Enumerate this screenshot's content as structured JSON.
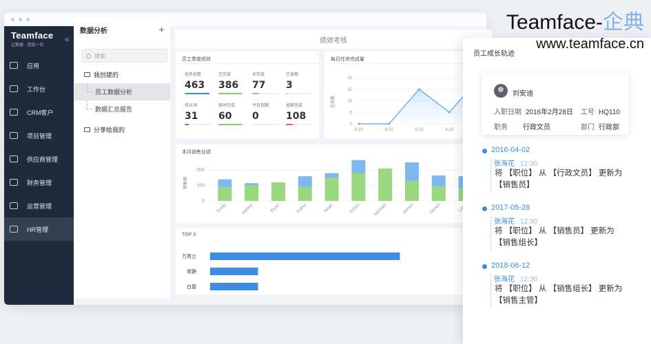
{
  "brand": {
    "name": "Teamface",
    "tagline": "让数据 · 连接一切",
    "collapse_icon": "double-chevron-left"
  },
  "nav": [
    {
      "label": "应用",
      "icon": "apps-icon"
    },
    {
      "label": "工作台",
      "icon": "workbench-icon"
    },
    {
      "label": "CRM客户",
      "icon": "customer-icon"
    },
    {
      "label": "项目管理",
      "icon": "project-icon"
    },
    {
      "label": "供应商管理",
      "icon": "supplier-icon"
    },
    {
      "label": "财务管理",
      "icon": "finance-icon"
    },
    {
      "label": "运营管理",
      "icon": "operations-icon"
    },
    {
      "label": "HR管理",
      "icon": "hr-icon",
      "active": true
    }
  ],
  "subpanel": {
    "title": "数据分析",
    "add": "+",
    "search_placeholder": "搜索",
    "group1": "我创建的",
    "items": [
      "员工数据分析",
      "数据汇总报告"
    ],
    "group2": "分享给我的"
  },
  "main": {
    "title": "绩效考核",
    "card1_title": "员工季度绩效",
    "stats": [
      {
        "label": "任务总数",
        "value": "463",
        "color": "#3d8ce6",
        "fill": 0.95
      },
      {
        "label": "已完成",
        "value": "386",
        "color": "#7ccf6b",
        "fill": 0.9
      },
      {
        "label": "未完成",
        "value": "77",
        "color": "#f29b8e",
        "fill": 0.25
      },
      {
        "label": "已逾期",
        "value": "3",
        "color": "#f29b8e",
        "fill": 0.05
      },
      {
        "label": "待认领",
        "value": "31",
        "color": "#3d8ce6",
        "fill": 0.15
      },
      {
        "label": "按时完成",
        "value": "60",
        "color": "#7ccf6b",
        "fill": 0.9
      },
      {
        "label": "今日到期",
        "value": "0",
        "color": "#f29b8e",
        "fill": 0.0
      },
      {
        "label": "逾期完成",
        "value": "108",
        "color": "#e85c4a",
        "fill": 0.25
      }
    ],
    "card2_title": "每日任务完成量",
    "card2_ylabel": "任务数",
    "card3_title": "本月销售业绩",
    "card3_ylabel": "销售额",
    "card4_title": "TOP 3"
  },
  "chart_data": [
    {
      "type": "line",
      "title": "每日任务完成量",
      "ylabel": "任务数",
      "x": [
        "6-20",
        "6-21",
        "6-22",
        "6-23",
        "6-24"
      ],
      "values": [
        0,
        0,
        15,
        5,
        20
      ],
      "yticks": [
        0,
        5,
        10,
        15,
        20
      ],
      "ylim": [
        0,
        20
      ],
      "color": "#5aa3ea"
    },
    {
      "type": "bar",
      "stacked": true,
      "title": "本月销售业绩",
      "ylabel": "销售额",
      "categories": [
        "Emily",
        "Ashley",
        "Ryan",
        "Kathy",
        "Noah",
        "Ethan",
        "Michael",
        "James",
        "Daniel",
        "Liam"
      ],
      "series": [
        {
          "values": [
            90,
            100,
            120,
            90,
            150,
            180,
            210,
            130,
            95,
            80
          ],
          "color": "#9bd77e"
        },
        {
          "values": [
            50,
            15,
            0,
            70,
            30,
            85,
            0,
            120,
            70,
            80
          ],
          "color": "#7db8ef"
        }
      ],
      "yticks": [
        0,
        100,
        200
      ],
      "ylim": [
        0,
        250
      ]
    },
    {
      "type": "bar",
      "orientation": "horizontal",
      "title": "TOP 3",
      "categories": [
        "万秀兰",
        "常静",
        "白霞"
      ],
      "values": [
        190,
        48,
        48
      ],
      "xticks": [
        0,
        40,
        80,
        120,
        160
      ],
      "color": "#3d8ce6"
    }
  ],
  "overlay": {
    "title": "员工成长轨迹",
    "profile": {
      "name": "刘安迪",
      "hire_label": "入职日期",
      "hire_value": "2016年2月28日",
      "id_label": "工号",
      "id_value": "HQ110",
      "pos_label": "职务",
      "pos_value": "行政文员",
      "dept_label": "部门",
      "dept_value": "行政部"
    },
    "timeline": [
      {
        "date": "2016-04-02",
        "who": "张海花",
        "time": "12:30",
        "line1": "将 【职位】 从 【行政文员】 更新为",
        "line2": "【销售员】"
      },
      {
        "date": "2017-05-28",
        "who": "张海花",
        "time": "12:30",
        "line1": "将 【职位】 从 【销售员】 更新为",
        "line2": "【销售组长】"
      },
      {
        "date": "2018-06-12",
        "who": "张海花",
        "time": "12:30",
        "line1": "将 【职位】 从 【销售组长】 更新为",
        "line2": "【销售主管】"
      }
    ]
  },
  "watermark": {
    "brand": "Teamface-",
    "brand_cn": "企典",
    "url": "www.teamface.cn"
  }
}
